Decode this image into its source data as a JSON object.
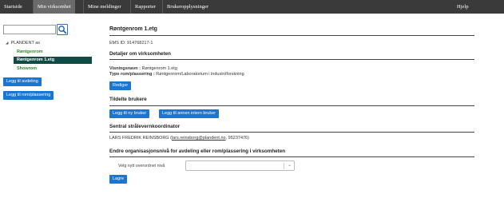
{
  "nav": {
    "items": [
      {
        "label": "Startside"
      },
      {
        "label": "Min virksomhet"
      },
      {
        "label": "Mine meldinger"
      },
      {
        "label": "Rapporter"
      },
      {
        "label": "Brukeropplysninger"
      }
    ],
    "help_label": "Hjelp",
    "active_index": 1
  },
  "sidebar": {
    "search": {
      "value": "",
      "placeholder": ""
    },
    "search_icon": "magnifier-icon",
    "tree": {
      "root_label": "PLANDENT as",
      "items": [
        {
          "label": "Røntgenrom"
        },
        {
          "label": "Røntgenrom 1.etg"
        },
        {
          "label": "Showrom"
        }
      ],
      "selected_index": 1
    },
    "add_department_label": "Legg til avdeling",
    "add_room_label": "Legg til rom/plassering"
  },
  "main": {
    "title": "Røntgenrom 1.etg",
    "ems_id": "EMS ID: 914768217-1",
    "details": {
      "heading": "Detaljer om virksomheten",
      "display_name_label": "Visningsnavn :",
      "display_name_value": " Røntgenrom 1.etg",
      "room_type_label": "Type rom/plassering :",
      "room_type_value": " Røntgenrom/Laboratorium i industri/forskning",
      "edit_label": "Rediger"
    },
    "users": {
      "heading": "Tildelte brukere",
      "add_new_user_label": "Legg til ny bruker",
      "add_internal_user_label": "Legg til annen intern bruker"
    },
    "coordinator": {
      "heading": "Sentral strålevernkoordinator",
      "name": "LARS FREDRIK REINSBORG (",
      "email": "lars.reinsborg@plandent.no",
      "phone": ", 95237476)"
    },
    "org": {
      "heading": "Endre organisasjonsnivå for avdeling eller rom/plassering i virksomheten",
      "parent_label": "Velg nytt overordnet nivå",
      "parent_value": "",
      "save_label": "Lagre"
    }
  },
  "colors": {
    "nav_bg": "#3a3a3a",
    "nav_active": "#6b6b6b",
    "primary": "#1976d2",
    "tree_green": "#2d8a2d",
    "tree_selected": "#114b45"
  }
}
